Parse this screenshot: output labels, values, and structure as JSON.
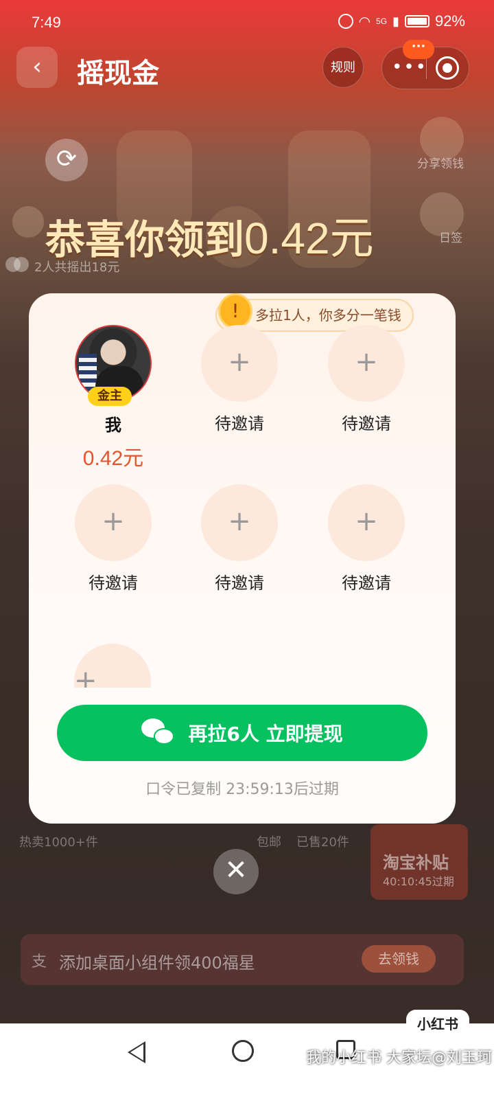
{
  "status_bar": {
    "time": "7:49",
    "network": "5G",
    "battery": "92%"
  },
  "header": {
    "title": "摇现金",
    "rules_label": "规则",
    "badge": "···"
  },
  "background": {
    "share_label": "分享领钱",
    "signin_label": "日签",
    "headline_prefix": "恭喜你领到",
    "headline_amount": "0.42元",
    "shook_text": "2人共摇出18元",
    "product_hot": "热卖1000+件",
    "free_shipping": "包邮",
    "sold": "已售20件",
    "subsidy_title": "淘宝补贴",
    "subsidy_timer": "40:10:45过期",
    "banner_text": "添加桌面小组件领400福星",
    "banner_button": "去领钱"
  },
  "modal": {
    "tip": "多拉1人，你多分一笔钱",
    "me": {
      "badge": "金主",
      "name": "我",
      "amount": "0.42元"
    },
    "slot_label": "待邀请",
    "slot_plus": "+",
    "cta_label": "再拉6人 立即提现",
    "expire_text": "口令已复制 23:59:13后过期"
  },
  "watermark": "我的小红书 大家坛@刘玉珂",
  "xhs_label": "小红书",
  "colors": {
    "cta_green": "#07c160",
    "amount_orange": "#e3552c",
    "badge_yellow": "#ffcf1a",
    "slot_pink": "#fde8dc"
  }
}
